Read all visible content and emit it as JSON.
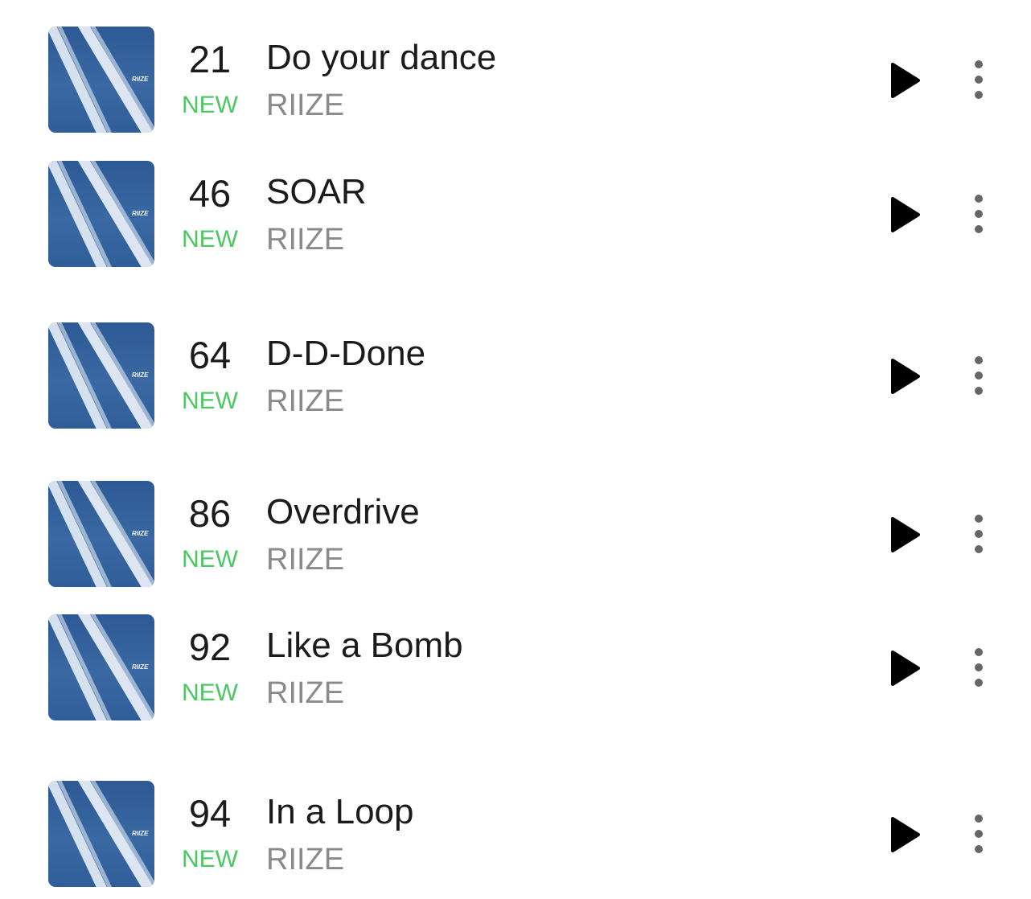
{
  "tracks": [
    {
      "rank": "21",
      "badge": "NEW",
      "title": "Do your dance",
      "artist": "RIIZE",
      "cover_logo": "RIIZE"
    },
    {
      "rank": "46",
      "badge": "NEW",
      "title": "SOAR",
      "artist": "RIIZE",
      "cover_logo": "RIIZE"
    },
    {
      "rank": "64",
      "badge": "NEW",
      "title": "D-D-Done",
      "artist": "RIIZE",
      "cover_logo": "RIIZE"
    },
    {
      "rank": "86",
      "badge": "NEW",
      "title": "Overdrive",
      "artist": "RIIZE",
      "cover_logo": "RIIZE"
    },
    {
      "rank": "92",
      "badge": "NEW",
      "title": "Like a Bomb",
      "artist": "RIIZE",
      "cover_logo": "RIIZE"
    },
    {
      "rank": "94",
      "badge": "NEW",
      "title": "In a Loop",
      "artist": "RIIZE",
      "cover_logo": "RIIZE"
    }
  ],
  "icons": {
    "play": "play-icon",
    "more": "more-vertical-icon"
  },
  "colors": {
    "badge_new": "#4cc764",
    "artist_text": "#8a8a8a",
    "primary_text": "#1b1b1b",
    "cover_blue": "#2d5a94"
  }
}
